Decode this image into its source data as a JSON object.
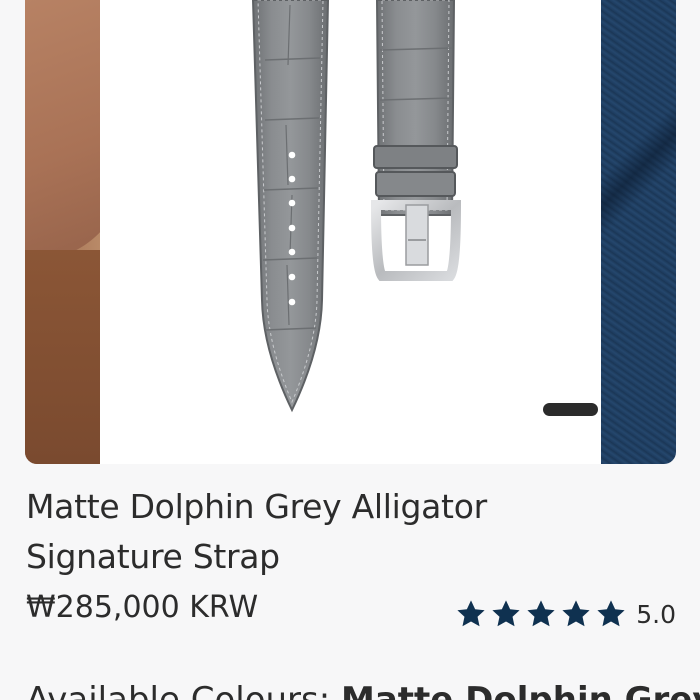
{
  "product": {
    "title_line1": "Matte Dolphin Grey Alligator",
    "title_line2": "Signature Strap",
    "price": "₩285,000 KRW",
    "rating_value": "5.0",
    "star_color": "#0f3150",
    "colour_label": "Available Colours: ",
    "colour_value": "Matte Dolphin Grey"
  },
  "gallery": {
    "images": [
      "wrist-photo",
      "strap-photo",
      "blue-leather-photo"
    ],
    "active_index": 1
  }
}
